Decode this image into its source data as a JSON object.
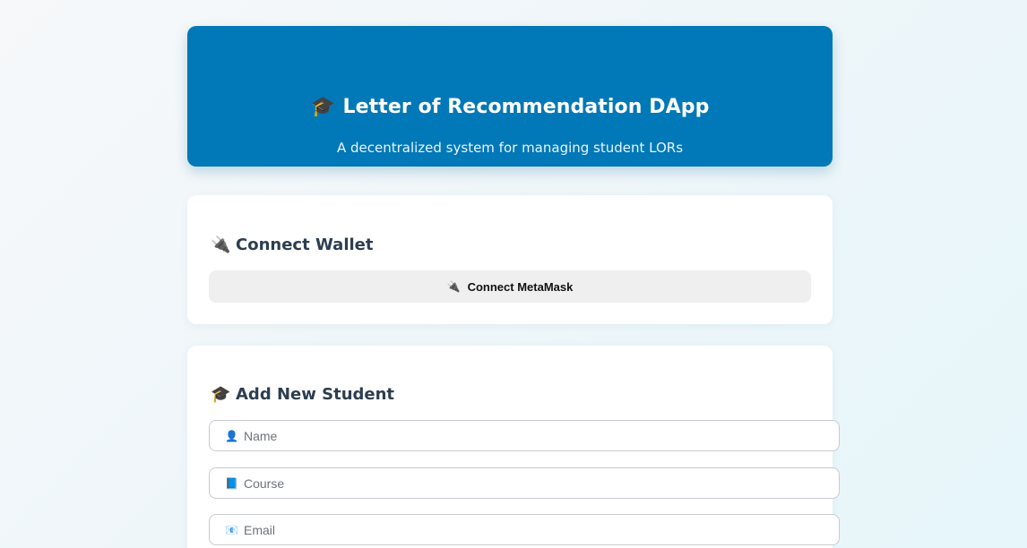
{
  "header": {
    "icon": "graduation-cap-icon",
    "icon_glyph": "🎓",
    "title": "Letter of Recommendation DApp",
    "subtitle": "A decentralized system for managing student LORs",
    "background_color": "#0178b7"
  },
  "wallet": {
    "icon": "plug-icon",
    "icon_glyph": "🔌",
    "heading": "Connect Wallet",
    "button_label": "Connect MetaMask"
  },
  "add_student": {
    "icon": "graduation-cap-icon",
    "icon_glyph": "🎓",
    "heading": "Add New Student",
    "fields": [
      {
        "icon": "person-icon",
        "icon_glyph": "👤",
        "placeholder": "Name"
      },
      {
        "icon": "book-icon",
        "icon_glyph": "📘",
        "placeholder": "Course"
      },
      {
        "icon": "email-icon",
        "icon_glyph": "📧",
        "placeholder": "Email"
      }
    ]
  }
}
